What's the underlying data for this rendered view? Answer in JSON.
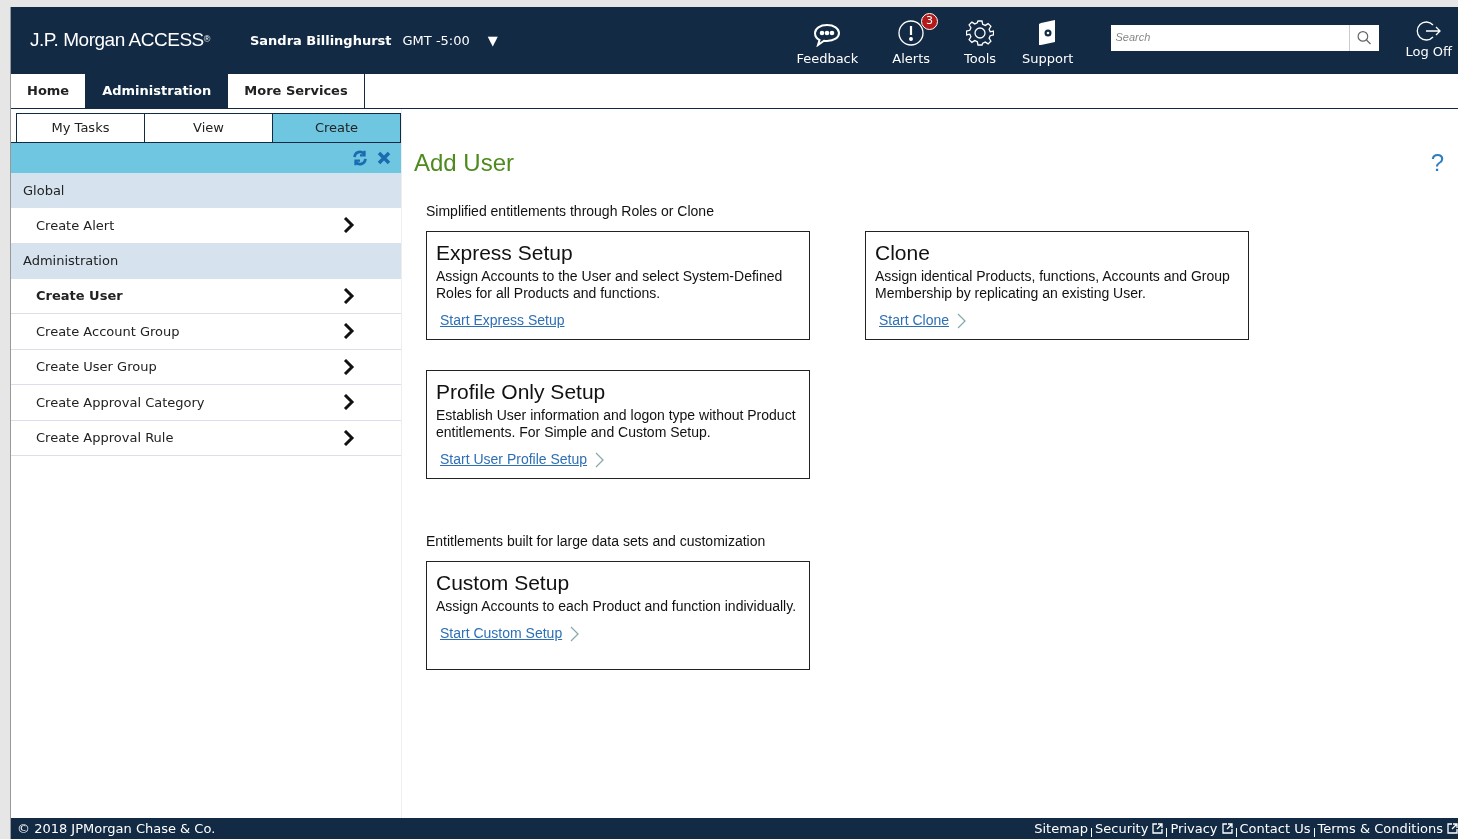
{
  "header": {
    "logo": "J.P. Morgan ACCESS",
    "logo_mark": "®",
    "user": "Sandra Billinghurst",
    "timezone": "GMT -5:00",
    "dropdown": "▼",
    "tools": [
      {
        "kind": "feedback",
        "label": "Feedback"
      },
      {
        "kind": "alerts",
        "label": "Alerts",
        "badge": "3"
      },
      {
        "kind": "tools",
        "label": "Tools"
      },
      {
        "kind": "support",
        "label": "Support"
      }
    ],
    "search": {
      "placeholder": "Search"
    },
    "logoff": "Log Off"
  },
  "nav_tabs": [
    {
      "label": "Home",
      "selected": false
    },
    {
      "label": "Administration",
      "selected": true
    },
    {
      "label": "More Services",
      "selected": false
    }
  ],
  "sub_tabs": [
    {
      "label": "My Tasks",
      "selected": false
    },
    {
      "label": "View",
      "selected": false
    },
    {
      "label": "Create",
      "selected": true
    }
  ],
  "sidebar": {
    "sections": [
      {
        "title": "Global",
        "items": [
          {
            "label": "Create Alert",
            "selected": false
          }
        ]
      },
      {
        "title": "Administration",
        "items": [
          {
            "label": "Create User",
            "selected": true
          },
          {
            "label": "Create Account Group",
            "selected": false
          },
          {
            "label": "Create User Group",
            "selected": false
          },
          {
            "label": "Create Approval Category",
            "selected": false
          },
          {
            "label": "Create Approval Rule",
            "selected": false
          }
        ]
      }
    ]
  },
  "page": {
    "title": "Add User",
    "help": "?",
    "groups": [
      {
        "heading": "Simplified entitlements through Roles or Clone",
        "cards": [
          {
            "title": "Express Setup",
            "text": "Assign Accounts to the User and select System-Defined Roles for all Products and functions.",
            "link": "Start Express Setup",
            "chevron": false
          },
          {
            "title": "Clone",
            "text": "Assign identical Products, functions, Accounts and Group Membership by replicating an existing User.",
            "link": "Start Clone",
            "chevron": true
          },
          {
            "title": "Profile Only Setup",
            "text": "Establish User information and logon type without Product entitlements. For Simple and Custom Setup.",
            "link": "Start User Profile Setup",
            "chevron": true
          }
        ]
      },
      {
        "heading": "Entitlements built for large data sets and customization",
        "cards": [
          {
            "title": "Custom Setup",
            "text": "Assign Accounts to each Product and function individually.",
            "link": "Start Custom Setup",
            "chevron": true
          }
        ]
      }
    ]
  },
  "footer": {
    "copyright": "© 2018 JPMorgan Chase & Co.",
    "links": [
      {
        "label": "Sitemap",
        "external": false
      },
      {
        "label": "Security",
        "external": true
      },
      {
        "label": "Privacy",
        "external": true
      },
      {
        "label": "Contact Us",
        "external": false
      },
      {
        "label": "Terms & Conditions",
        "external": true
      }
    ]
  }
}
